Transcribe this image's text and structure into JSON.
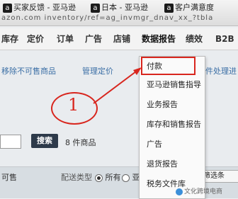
{
  "browser": {
    "bookmarks": [
      {
        "icon": "amazon",
        "label": "买家反馈 - 亚马逊"
      },
      {
        "icon": "amazon",
        "label": "日本 - 亚马逊"
      },
      {
        "icon": "amazon",
        "label": "客户满意度"
      }
    ],
    "url_fragment": "azon.com  inventory/ref=ag_invmgr_dnav_xx_?tbla"
  },
  "nav": {
    "items": [
      "库存",
      "定价",
      "订单",
      "广告",
      "店铺",
      "数据报告",
      "绩效",
      "B2B"
    ],
    "active": "数据报告"
  },
  "page": {
    "link_left": "移除不可售商品",
    "link_manage": "管理定价",
    "link_right": "件处理进",
    "search_button": "搜索",
    "result_count": "8 件商品",
    "filter_label": "可售",
    "shipping_type_label": "配送类型",
    "radio_all": "所有",
    "radio_amazon": "亚马逊",
    "right_control": "其他筛选条"
  },
  "dropdown": {
    "items": [
      "付款",
      "亚马逊销售指导",
      "业务报告",
      "库存和销售报告",
      "广告",
      "退货报告",
      "税务文件库"
    ],
    "highlighted": "付款"
  },
  "annotation": {
    "number": "1",
    "color": "#d8261e"
  },
  "watermark": "文化跨境电商"
}
